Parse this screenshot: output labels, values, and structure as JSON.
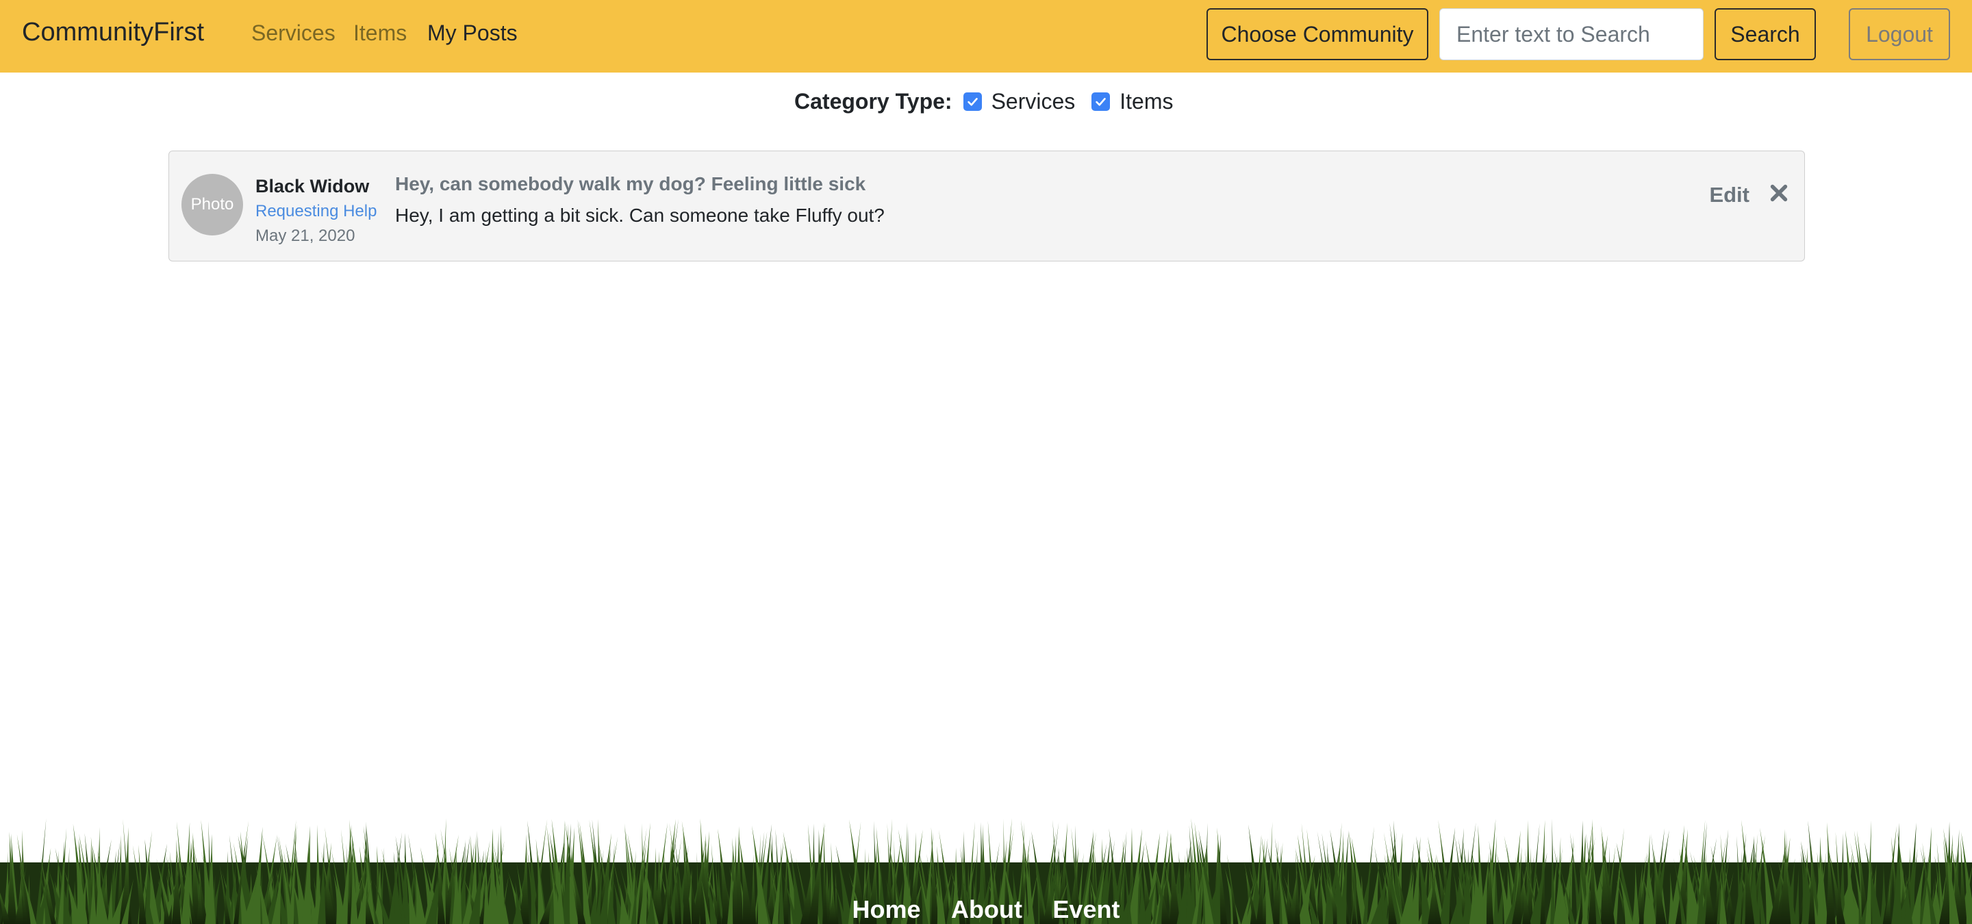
{
  "header": {
    "brand": "CommunityFirst",
    "nav": [
      {
        "label": "Services",
        "active": false
      },
      {
        "label": "Items",
        "active": false
      },
      {
        "label": "My Posts",
        "active": true
      }
    ],
    "choose_community_label": "Choose Community",
    "search_placeholder": "Enter text to Search",
    "search_value": "",
    "search_label": "Search",
    "logout_label": "Logout",
    "accent_color": "#f6c244"
  },
  "filter": {
    "label": "Category Type:",
    "options": [
      {
        "label": "Services",
        "checked": true
      },
      {
        "label": "Items",
        "checked": true
      }
    ],
    "check_color": "#3b82f6"
  },
  "posts": [
    {
      "avatar_text": "Photo",
      "author": "Black Widow",
      "type": "Requesting Help",
      "date": "May 21, 2020",
      "title": "Hey, can somebody walk my dog? Feeling little sick",
      "body": "Hey, I am getting a bit sick. Can someone take Fluffy out?",
      "edit_label": "Edit",
      "close_icon": "close-icon"
    }
  ],
  "footer": {
    "links": [
      "Home",
      "About",
      "Event"
    ]
  }
}
